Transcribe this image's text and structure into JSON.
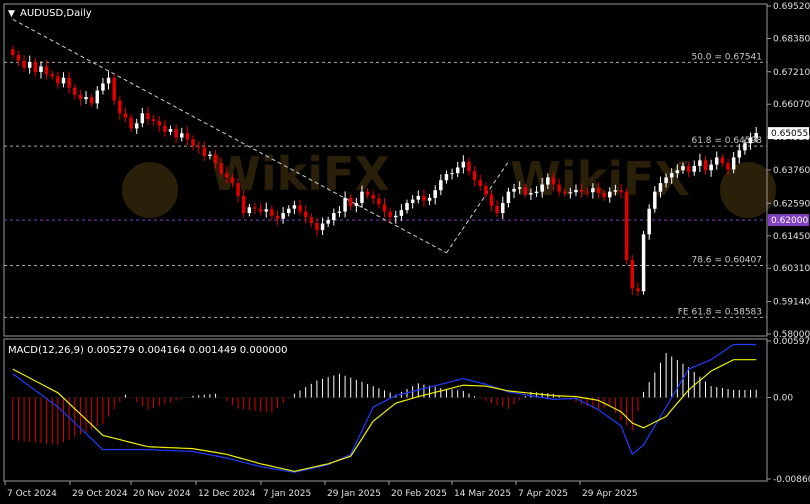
{
  "chart_title": "AUDUSD,Daily",
  "watermark": "WikiFX",
  "colors": {
    "background": "#000000",
    "bull": "#ffffff",
    "bear": "#e00000",
    "macd_line": "#1e3cff",
    "signal_line": "#f0f000",
    "level_line": "#aaaaaa",
    "support_line": "#7f3fbf",
    "label_bg": "#ffffff",
    "support_label_bg": "#8040c0"
  },
  "chart_data": [
    {
      "type": "candlestick",
      "title": "AUDUSD,Daily",
      "ylim": [
        0.58,
        0.6952
      ],
      "y_ticks": [
        "0.69520",
        "0.68380",
        "0.67210",
        "0.66070",
        "0.64920",
        "0.63760",
        "0.62590",
        "0.61450",
        "0.60310",
        "0.59140",
        "0.58000"
      ],
      "x_ticks": [
        "7 Oct 2024",
        "29 Oct 2024",
        "20 Nov 2024",
        "12 Dec 2024",
        "7 Jan 2025",
        "29 Jan 2025",
        "20 Feb 2025",
        "14 Mar 2025",
        "7 Apr 2025",
        "29 Apr 2025"
      ],
      "levels": [
        {
          "label": "50.0 = 0.67541",
          "value": 0.67541
        },
        {
          "label": "61.8 = 0.64598",
          "value": 0.64598
        },
        {
          "label": "78.6 = 0.60407",
          "value": 0.60407
        },
        {
          "label": "FE 61.8 = 0.58583",
          "value": 0.58583
        }
      ],
      "support": {
        "label": "0.62000",
        "value": 0.62
      },
      "current_price": {
        "label": "0.65055",
        "value": 0.65055
      },
      "trend_line": [
        {
          "i": 0,
          "price": 0.6905
        },
        {
          "i": 77,
          "price": 0.6085
        }
      ],
      "closes": [
        0.678,
        0.676,
        0.6735,
        0.6755,
        0.672,
        0.674,
        0.6712,
        0.6705,
        0.668,
        0.67,
        0.6665,
        0.664,
        0.6625,
        0.6632,
        0.661,
        0.6655,
        0.668,
        0.67,
        0.662,
        0.6575,
        0.656,
        0.6522,
        0.654,
        0.6575,
        0.6555,
        0.6548,
        0.6532,
        0.651,
        0.652,
        0.649,
        0.6505,
        0.6484,
        0.646,
        0.6455,
        0.6425,
        0.643,
        0.64,
        0.6365,
        0.635,
        0.633,
        0.6285,
        0.6225,
        0.6245,
        0.624,
        0.623,
        0.6238,
        0.6215,
        0.6205,
        0.6225,
        0.624,
        0.6252,
        0.623,
        0.621,
        0.619,
        0.6165,
        0.6188,
        0.62,
        0.6225,
        0.623,
        0.6278,
        0.625,
        0.626,
        0.63,
        0.6288,
        0.6275,
        0.6255,
        0.623,
        0.621,
        0.6215,
        0.6235,
        0.626,
        0.6272,
        0.6285,
        0.6268,
        0.6278,
        0.6305,
        0.634,
        0.6362,
        0.6365,
        0.6385,
        0.6405,
        0.6372,
        0.634,
        0.632,
        0.629,
        0.625,
        0.6225,
        0.626,
        0.63,
        0.631,
        0.6315,
        0.629,
        0.6295,
        0.63,
        0.6325,
        0.635,
        0.6325,
        0.63,
        0.6295,
        0.6298,
        0.6306,
        0.63,
        0.6298,
        0.6312,
        0.6295,
        0.628,
        0.63,
        0.6305,
        0.6298,
        0.606,
        0.596,
        0.595,
        0.615,
        0.624,
        0.63,
        0.633,
        0.635,
        0.6365,
        0.6375,
        0.639,
        0.637,
        0.639,
        0.641,
        0.6375,
        0.6395,
        0.642,
        0.64,
        0.6378,
        0.642,
        0.6445,
        0.647,
        0.649,
        0.6506
      ]
    },
    {
      "type": "histogram+line",
      "title": "MACD(12,26,9) 0.005279 0.004164 0.001449 0.000000",
      "ylim": [
        -0.008607,
        0.005971
      ],
      "y_ticks": [
        "0.005971",
        "0.00",
        "-0.008607"
      ],
      "series": [
        {
          "name": "histogram",
          "points": [
            [
              0,
              -0.0045
            ],
            [
              8,
              -0.005
            ],
            [
              16,
              -0.0028
            ],
            [
              20,
              0.0003
            ],
            [
              24,
              -0.0013
            ],
            [
              28,
              -0.0005
            ],
            [
              32,
              0.0002
            ],
            [
              36,
              0.0004
            ],
            [
              40,
              -0.0012
            ],
            [
              46,
              -0.0016
            ],
            [
              50,
              0.0004
            ],
            [
              54,
              0.0018
            ],
            [
              58,
              0.0025
            ],
            [
              60,
              0.0021
            ],
            [
              64,
              0.0012
            ],
            [
              68,
              0.0003
            ],
            [
              72,
              0.0015
            ],
            [
              76,
              0.001
            ],
            [
              80,
              0.0007
            ],
            [
              84,
              -0.0004
            ],
            [
              88,
              -0.0012
            ],
            [
              92,
              0.0006
            ],
            [
              96,
              0.0004
            ],
            [
              100,
              -0.0005
            ],
            [
              104,
              -0.0014
            ],
            [
              106,
              -0.0008
            ],
            [
              108,
              -0.0024
            ],
            [
              110,
              -0.0035
            ],
            [
              112,
              0.0006
            ],
            [
              116,
              0.0047
            ],
            [
              120,
              0.0032
            ],
            [
              124,
              0.0012
            ],
            [
              128,
              0.0008
            ]
          ]
        },
        {
          "name": "macd",
          "points": [
            [
              0,
              0.0025
            ],
            [
              8,
              -0.001
            ],
            [
              16,
              -0.0055
            ],
            [
              24,
              -0.0055
            ],
            [
              32,
              -0.0057
            ],
            [
              38,
              -0.0064
            ],
            [
              44,
              -0.0073
            ],
            [
              50,
              -0.0079
            ],
            [
              56,
              -0.0071
            ],
            [
              60,
              -0.006
            ],
            [
              64,
              -0.001
            ],
            [
              68,
              0.0002
            ],
            [
              72,
              0.0008
            ],
            [
              80,
              0.002
            ],
            [
              84,
              0.0014
            ],
            [
              88,
              0.0006
            ],
            [
              96,
              -0.0002
            ],
            [
              100,
              -0.0001
            ],
            [
              104,
              -0.0013
            ],
            [
              108,
              -0.003
            ],
            [
              110,
              -0.006
            ],
            [
              112,
              -0.005
            ],
            [
              116,
              -0.001
            ],
            [
              120,
              0.003
            ],
            [
              124,
              0.004
            ],
            [
              128,
              0.0056
            ]
          ]
        },
        {
          "name": "signal",
          "points": [
            [
              0,
              0.003
            ],
            [
              8,
              0.0005
            ],
            [
              16,
              -0.004
            ],
            [
              24,
              -0.0052
            ],
            [
              32,
              -0.0054
            ],
            [
              38,
              -0.006
            ],
            [
              44,
              -0.007
            ],
            [
              50,
              -0.0078
            ],
            [
              56,
              -0.007
            ],
            [
              60,
              -0.0062
            ],
            [
              64,
              -0.0025
            ],
            [
              68,
              -0.0006
            ],
            [
              72,
              0.0001
            ],
            [
              80,
              0.0013
            ],
            [
              84,
              0.0012
            ],
            [
              88,
              0.0007
            ],
            [
              96,
              0.0002
            ],
            [
              100,
              0.0001
            ],
            [
              104,
              -0.0003
            ],
            [
              108,
              -0.0015
            ],
            [
              110,
              -0.0027
            ],
            [
              112,
              -0.0032
            ],
            [
              116,
              -0.002
            ],
            [
              120,
              0.0008
            ],
            [
              124,
              0.0028
            ],
            [
              128,
              0.004
            ]
          ]
        }
      ]
    }
  ]
}
